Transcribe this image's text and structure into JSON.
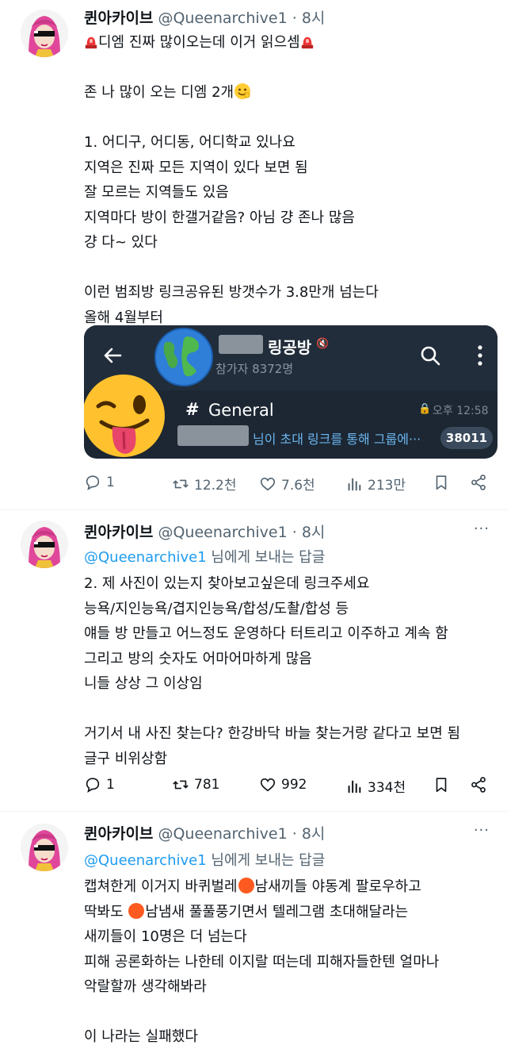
{
  "tweets": [
    {
      "author_name": "퀸아카이브",
      "handle": "@Queenarchive1",
      "separator": "·",
      "time": "8시",
      "more_icon": "ellipsis-icon",
      "lines": [
        "디엠 진짜 많이오는데 이거 읽으셈",
        "",
        "존 나 많이 오는 디엠 2개",
        "",
        "1. 어디구, 어디동, 어디학교 있나요",
        "지역은 진짜 모든 지역이 있다 보면 됨",
        "잘 모르는 지역들도 있음",
        "지역마다 방이 한갤거같음? 아님 걍 존나 많음",
        "걍 다~ 있다",
        "",
        "이런 범죄방 링크공유된 방갯수가 3.8만개 넘는다",
        "올해 4월부터"
      ],
      "actions": {
        "replies": "1",
        "retweets": "12.2천",
        "likes": "7.6천",
        "views": "213만"
      }
    },
    {
      "author_name": "퀸아카이브",
      "handle": "@Queenarchive1",
      "separator": "·",
      "time": "8시",
      "reply_mention": "@Queenarchive1",
      "reply_suffix": " 님에게 보내는 답글",
      "lines": [
        "2. 제 사진이 있는지 찾아보고싶은데 링크주세요",
        "능욕/지인능욕/겹지인능욕/합성/도촬/합성 등",
        "얘들 방 만들고 어느정도 운영하다 터트리고 이주하고 계속 함",
        "그리고 방의 숫자도 어마어마하게 많음",
        "니들 상상 그 이상임",
        "",
        "거기서 내 사진 찾는다? 한강바닥 바늘 찾는거랑 같다고 보면 됨",
        "글구 비위상함"
      ],
      "actions": {
        "replies": "1",
        "retweets": "781",
        "likes": "992",
        "views": "334천"
      }
    },
    {
      "author_name": "퀸아카이브",
      "handle": "@Queenarchive1",
      "separator": "·",
      "time": "8시",
      "reply_mention": "@Queenarchive1",
      "reply_suffix": " 님에게 보내는 답글",
      "line1_a": "캡쳐한게 이거지 바퀴벌레",
      "line1_b": "남새끼들 야동계 팔로우하고",
      "line2_a": "딱봐도",
      "line2_b": "남냄새 풀풀풍기면서 텔레그램 초대해달라는",
      "lines": [
        "새끼들이 10명은 더 넘는다",
        "피해 공론화하는 나한테 이지랄 떠는데 피해자들한텐 얼마나",
        "악랄할까 생각해봐라",
        "",
        "이 나라는 실패했다"
      ]
    }
  ],
  "media": {
    "group_title": "링공방",
    "members": "참가자 8372명",
    "channel_hash": "#",
    "channel_name": "General",
    "message_time": "오후 12:58",
    "preview": "님이 초대 링크를 통해 그룹에···",
    "unread_count": "38011",
    "icons": [
      "back-arrow-icon",
      "globe-icon",
      "search-icon",
      "kebab-menu-icon",
      "winking-tongue-emoji",
      "lock-icon",
      "mute-icon"
    ]
  },
  "colors": {
    "link": "#1d9bf0",
    "secondary": "#536471",
    "telegram_dark": "#1c2733"
  }
}
